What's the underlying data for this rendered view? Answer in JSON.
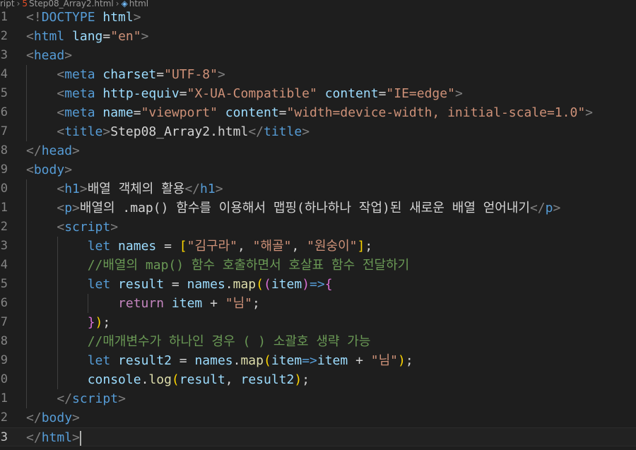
{
  "breadcrumb": {
    "items": [
      "ript",
      "Step08_Array2.html",
      "html"
    ],
    "file_icon": "html5-file-icon",
    "symbol_icon": "cube-symbol-icon"
  },
  "colors": {
    "background": "#1e1e1e",
    "tag": "#569cd6",
    "attribute": "#9cdcfe",
    "string": "#ce9178",
    "control_keyword": "#c586c0",
    "function": "#dcdcaa",
    "comment": "#6a9955"
  },
  "editor": {
    "line_numbers": [
      "1",
      "2",
      "3",
      "4",
      "5",
      "6",
      "7",
      "8",
      "9",
      "0",
      "1",
      "2",
      "3",
      "4",
      "5",
      "6",
      "7",
      "8",
      "9",
      "0",
      "1",
      "2",
      "3"
    ],
    "lines": [
      [
        {
          "c": "t-punc",
          "t": "<!"
        },
        {
          "c": "t-tag",
          "t": "DOCTYPE"
        },
        {
          "c": "t-attr",
          "t": " html"
        },
        {
          "c": "t-punc",
          "t": ">"
        }
      ],
      [
        {
          "c": "t-punc",
          "t": "<"
        },
        {
          "c": "t-tag",
          "t": "html"
        },
        {
          "c": "t-attr",
          "t": " lang"
        },
        {
          "c": "t-op",
          "t": "="
        },
        {
          "c": "t-str",
          "t": "\"en\""
        },
        {
          "c": "t-punc",
          "t": ">"
        }
      ],
      [
        {
          "c": "t-punc",
          "t": "<"
        },
        {
          "c": "t-tag",
          "t": "head"
        },
        {
          "c": "t-punc",
          "t": ">"
        }
      ],
      [
        {
          "c": "t-text",
          "t": "    "
        },
        {
          "c": "t-punc",
          "t": "<"
        },
        {
          "c": "t-tag",
          "t": "meta"
        },
        {
          "c": "t-attr",
          "t": " charset"
        },
        {
          "c": "t-op",
          "t": "="
        },
        {
          "c": "t-str",
          "t": "\"UTF-8\""
        },
        {
          "c": "t-punc",
          "t": ">"
        }
      ],
      [
        {
          "c": "t-text",
          "t": "    "
        },
        {
          "c": "t-punc",
          "t": "<"
        },
        {
          "c": "t-tag",
          "t": "meta"
        },
        {
          "c": "t-attr",
          "t": " http-equiv"
        },
        {
          "c": "t-op",
          "t": "="
        },
        {
          "c": "t-str",
          "t": "\"X-UA-Compatible\""
        },
        {
          "c": "t-attr",
          "t": " content"
        },
        {
          "c": "t-op",
          "t": "="
        },
        {
          "c": "t-str",
          "t": "\"IE=edge\""
        },
        {
          "c": "t-punc",
          "t": ">"
        }
      ],
      [
        {
          "c": "t-text",
          "t": "    "
        },
        {
          "c": "t-punc",
          "t": "<"
        },
        {
          "c": "t-tag",
          "t": "meta"
        },
        {
          "c": "t-attr",
          "t": " name"
        },
        {
          "c": "t-op",
          "t": "="
        },
        {
          "c": "t-str",
          "t": "\"viewport\""
        },
        {
          "c": "t-attr",
          "t": " content"
        },
        {
          "c": "t-op",
          "t": "="
        },
        {
          "c": "t-str",
          "t": "\"width=device-width, initial-scale=1.0\""
        },
        {
          "c": "t-punc",
          "t": ">"
        }
      ],
      [
        {
          "c": "t-text",
          "t": "    "
        },
        {
          "c": "t-punc",
          "t": "<"
        },
        {
          "c": "t-tag",
          "t": "title"
        },
        {
          "c": "t-punc",
          "t": ">"
        },
        {
          "c": "t-text",
          "t": "Step08_Array2.html"
        },
        {
          "c": "t-punc",
          "t": "</"
        },
        {
          "c": "t-tag",
          "t": "title"
        },
        {
          "c": "t-punc",
          "t": ">"
        }
      ],
      [
        {
          "c": "t-punc",
          "t": "</"
        },
        {
          "c": "t-tag",
          "t": "head"
        },
        {
          "c": "t-punc",
          "t": ">"
        }
      ],
      [
        {
          "c": "t-punc",
          "t": "<"
        },
        {
          "c": "t-tag",
          "t": "body"
        },
        {
          "c": "t-punc",
          "t": ">"
        }
      ],
      [
        {
          "c": "t-text",
          "t": "    "
        },
        {
          "c": "t-punc",
          "t": "<"
        },
        {
          "c": "t-tag",
          "t": "h1"
        },
        {
          "c": "t-punc",
          "t": ">"
        },
        {
          "c": "t-text",
          "t": "배열 객체의 활용"
        },
        {
          "c": "t-punc",
          "t": "</"
        },
        {
          "c": "t-tag",
          "t": "h1"
        },
        {
          "c": "t-punc",
          "t": ">"
        }
      ],
      [
        {
          "c": "t-text",
          "t": "    "
        },
        {
          "c": "t-punc",
          "t": "<"
        },
        {
          "c": "t-tag",
          "t": "p"
        },
        {
          "c": "t-punc",
          "t": ">"
        },
        {
          "c": "t-text",
          "t": "배열의 .map() 함수를 이용해서 맵핑(하나하나 작업)된 새로운 배열 얻어내기"
        },
        {
          "c": "t-punc",
          "t": "</"
        },
        {
          "c": "t-tag",
          "t": "p"
        },
        {
          "c": "t-punc",
          "t": ">"
        }
      ],
      [
        {
          "c": "t-text",
          "t": "    "
        },
        {
          "c": "t-punc",
          "t": "<"
        },
        {
          "c": "t-tag",
          "t": "script"
        },
        {
          "c": "t-punc",
          "t": ">"
        }
      ],
      [
        {
          "c": "t-text",
          "t": "        "
        },
        {
          "c": "t-kw",
          "t": "let"
        },
        {
          "c": "t-var",
          "t": " names"
        },
        {
          "c": "t-op",
          "t": " = "
        },
        {
          "c": "t-b1",
          "t": "["
        },
        {
          "c": "t-str",
          "t": "\"김구라\""
        },
        {
          "c": "t-op",
          "t": ", "
        },
        {
          "c": "t-str",
          "t": "\"해골\""
        },
        {
          "c": "t-op",
          "t": ", "
        },
        {
          "c": "t-str",
          "t": "\"원숭이\""
        },
        {
          "c": "t-b1",
          "t": "]"
        },
        {
          "c": "t-op",
          "t": ";"
        }
      ],
      [
        {
          "c": "t-text",
          "t": "        "
        },
        {
          "c": "t-cm",
          "t": "//배열의 map() 함수 호출하면서 호살표 함수 전달하기"
        }
      ],
      [
        {
          "c": "t-text",
          "t": "        "
        },
        {
          "c": "t-kw",
          "t": "let"
        },
        {
          "c": "t-var",
          "t": " result"
        },
        {
          "c": "t-op",
          "t": " = "
        },
        {
          "c": "t-var",
          "t": "names"
        },
        {
          "c": "t-op",
          "t": "."
        },
        {
          "c": "t-fn",
          "t": "map"
        },
        {
          "c": "t-b1",
          "t": "("
        },
        {
          "c": "t-b2",
          "t": "("
        },
        {
          "c": "t-var",
          "t": "item"
        },
        {
          "c": "t-b2",
          "t": ")"
        },
        {
          "c": "t-kw",
          "t": "=>"
        },
        {
          "c": "t-b2",
          "t": "{"
        }
      ],
      [
        {
          "c": "t-text",
          "t": "            "
        },
        {
          "c": "t-ctl",
          "t": "return"
        },
        {
          "c": "t-var",
          "t": " item"
        },
        {
          "c": "t-op",
          "t": " + "
        },
        {
          "c": "t-str",
          "t": "\"님\""
        },
        {
          "c": "t-op",
          "t": ";"
        }
      ],
      [
        {
          "c": "t-text",
          "t": "        "
        },
        {
          "c": "t-b2",
          "t": "}"
        },
        {
          "c": "t-b1",
          "t": ")"
        },
        {
          "c": "t-op",
          "t": ";"
        }
      ],
      [
        {
          "c": "t-text",
          "t": "        "
        },
        {
          "c": "t-cm",
          "t": "//매개변수가 하나인 경우 ( ) 소괄호 생략 가능"
        }
      ],
      [
        {
          "c": "t-text",
          "t": "        "
        },
        {
          "c": "t-kw",
          "t": "let"
        },
        {
          "c": "t-var",
          "t": " result2"
        },
        {
          "c": "t-op",
          "t": " = "
        },
        {
          "c": "t-var",
          "t": "names"
        },
        {
          "c": "t-op",
          "t": "."
        },
        {
          "c": "t-fn",
          "t": "map"
        },
        {
          "c": "t-b1",
          "t": "("
        },
        {
          "c": "t-var",
          "t": "item"
        },
        {
          "c": "t-kw",
          "t": "=>"
        },
        {
          "c": "t-var",
          "t": "item"
        },
        {
          "c": "t-op",
          "t": " + "
        },
        {
          "c": "t-str",
          "t": "\"님\""
        },
        {
          "c": "t-b1",
          "t": ")"
        },
        {
          "c": "t-op",
          "t": ";"
        }
      ],
      [
        {
          "c": "t-text",
          "t": "        "
        },
        {
          "c": "t-var",
          "t": "console"
        },
        {
          "c": "t-op",
          "t": "."
        },
        {
          "c": "t-fn",
          "t": "log"
        },
        {
          "c": "t-b1",
          "t": "("
        },
        {
          "c": "t-var",
          "t": "result"
        },
        {
          "c": "t-op",
          "t": ", "
        },
        {
          "c": "t-var",
          "t": "result2"
        },
        {
          "c": "t-b1",
          "t": ")"
        },
        {
          "c": "t-op",
          "t": ";"
        }
      ],
      [
        {
          "c": "t-text",
          "t": "    "
        },
        {
          "c": "t-punc",
          "t": "</"
        },
        {
          "c": "t-tag",
          "t": "script"
        },
        {
          "c": "t-punc",
          "t": ">"
        }
      ],
      [
        {
          "c": "t-punc",
          "t": "</"
        },
        {
          "c": "t-tag",
          "t": "body"
        },
        {
          "c": "t-punc",
          "t": ">"
        }
      ],
      [
        {
          "c": "t-punc",
          "t": "</"
        },
        {
          "c": "t-tag",
          "t": "html"
        },
        {
          "c": "t-punc",
          "t": ">"
        }
      ]
    ],
    "active_line": 23
  }
}
